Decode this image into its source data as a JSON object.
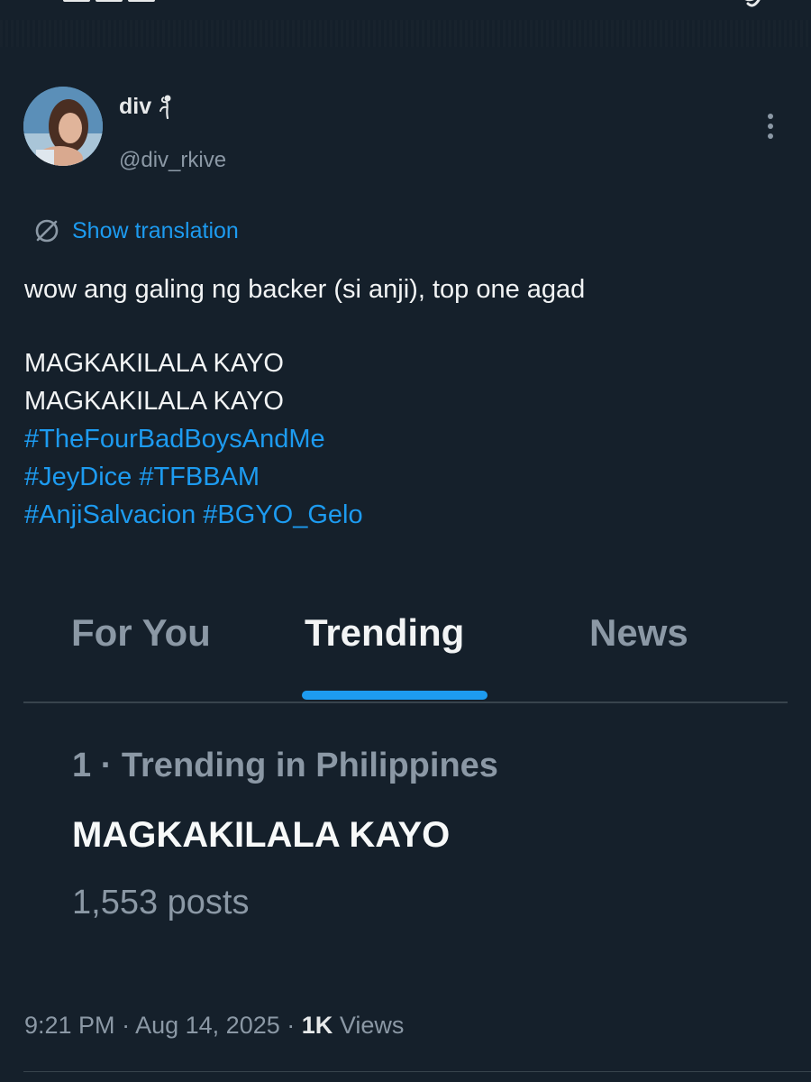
{
  "author": {
    "display_name": "div",
    "handle": "@div_rkive"
  },
  "translation": {
    "label": "Show translation"
  },
  "tweet": {
    "line1": "wow ang galing ng backer (si anji), top one agad",
    "line2": "MAGKAKILALA KAYO",
    "line3": "MAGKAKILALA KAYO",
    "hashtag1": "#TheFourBadBoysAndMe",
    "hashtag2": "#JeyDice",
    "hashtag3": "#TFBBAM",
    "hashtag4": "#AnjiSalvacion",
    "hashtag5": "#BGYO_Gelo"
  },
  "trending_screenshot": {
    "tabs": {
      "for_you": "For You",
      "trending": "Trending",
      "news": "News"
    },
    "active_tab": "Trending",
    "trend_meta": "1 · Trending in Philippines",
    "trend_name": "MAGKAKILALA KAYO",
    "trend_posts": "1,553 posts"
  },
  "meta": {
    "time": "9:21 PM",
    "separator": "·",
    "date": "Aug 14, 2025",
    "views_count": "1K",
    "views_label": "Views"
  },
  "colors": {
    "background": "#15202b",
    "accent": "#1d9bf0",
    "secondary_text": "#8b98a5",
    "divider": "#38444d"
  }
}
